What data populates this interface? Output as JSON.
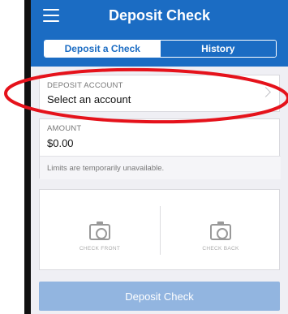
{
  "header": {
    "title": "Deposit Check",
    "menu_icon": "hamburger-menu-icon",
    "background": "#1b6cc3"
  },
  "tabs": [
    {
      "label": "Deposit a Check",
      "active": true
    },
    {
      "label": "History",
      "active": false
    }
  ],
  "account": {
    "label": "DEPOSIT ACCOUNT",
    "value": "Select an account",
    "icon": "chevron-right-icon"
  },
  "amount": {
    "label": "AMOUNT",
    "value": "$0.00",
    "notice": "Limits are temporarily unavailable."
  },
  "photos": {
    "front_label": "CHECK FRONT",
    "back_label": "CHECK BACK",
    "icon": "camera-icon"
  },
  "deposit_button": {
    "label": "Deposit Check",
    "color": "#92b5e0"
  },
  "annotation": {
    "shape": "ellipse",
    "color": "#e5121b"
  }
}
